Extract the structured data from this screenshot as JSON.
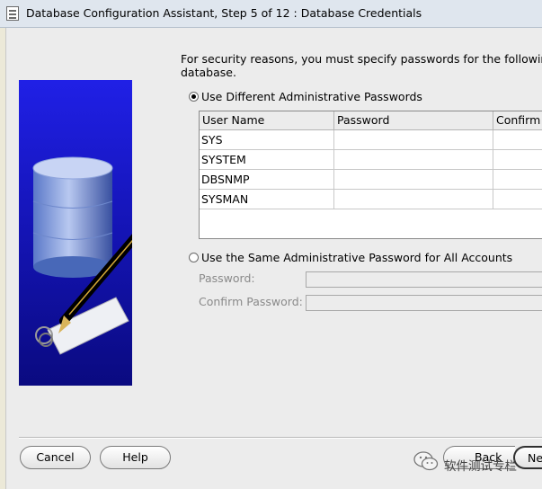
{
  "window": {
    "title": "Database Configuration Assistant, Step 5 of 12 : Database Credentials"
  },
  "intro": {
    "line1": "For security reasons, you must specify passwords for the following use",
    "line2": "database."
  },
  "options": {
    "different": {
      "label": "Use Different Administrative Passwords",
      "selected": true
    },
    "same": {
      "label": "Use the Same Administrative Password for All Accounts",
      "selected": false
    }
  },
  "table": {
    "columns": [
      "User Name",
      "Password",
      "Confirm P"
    ],
    "rows": [
      {
        "user": "SYS",
        "password": "",
        "confirm": ""
      },
      {
        "user": "SYSTEM",
        "password": "",
        "confirm": ""
      },
      {
        "user": "DBSNMP",
        "password": "",
        "confirm": ""
      },
      {
        "user": "SYSMAN",
        "password": "",
        "confirm": ""
      }
    ]
  },
  "shared": {
    "password_label": "Password:",
    "confirm_label": "Confirm Password:"
  },
  "buttons": {
    "cancel": "Cancel",
    "help": "Help",
    "back": "Back",
    "next": "Ne"
  },
  "watermark": {
    "text": "软件测试专栏"
  },
  "colors": {
    "art_blue": "#2020e6",
    "window_bg": "#ececec"
  }
}
